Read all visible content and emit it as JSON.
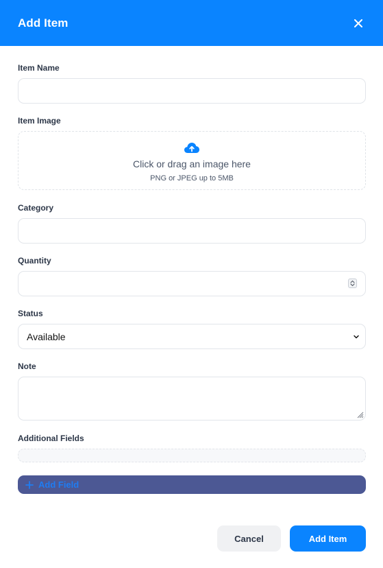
{
  "dialog": {
    "title": "Add Item",
    "close_icon": "close-icon"
  },
  "colors": {
    "header": "#0a84ff",
    "primary": "#0a84ff",
    "add_field_bg": "#4c5894",
    "add_field_text": "#1f7cf2",
    "cancel_bg": "#f0f1f3"
  },
  "form": {
    "item_name": {
      "label": "Item Name",
      "value": ""
    },
    "item_image": {
      "label": "Item Image",
      "dropzone_text": "Click or drag an image here",
      "dropzone_hint": "PNG or JPEG up to 5MB",
      "icon": "cloud-upload-icon"
    },
    "category": {
      "label": "Category",
      "value": ""
    },
    "quantity": {
      "label": "Quantity",
      "value": ""
    },
    "status": {
      "label": "Status",
      "selected": "Available"
    },
    "note": {
      "label": "Note",
      "value": ""
    },
    "additional_fields": {
      "label": "Additional Fields",
      "add_button_label": "Add Field",
      "add_icon": "plus-icon"
    }
  },
  "footer": {
    "cancel_label": "Cancel",
    "submit_label": "Add Item"
  }
}
